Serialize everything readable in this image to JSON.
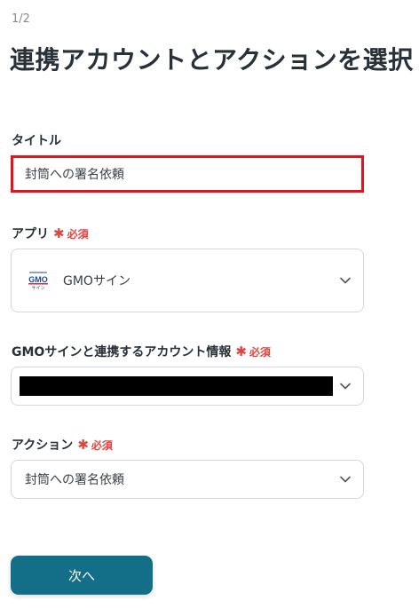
{
  "header": {
    "step": "1/2",
    "title": "連携アカウントとアクションを選択"
  },
  "required_label": "必須",
  "title_field": {
    "label": "タイトル",
    "value": "封筒への署名依頼"
  },
  "app_field": {
    "label": "アプリ",
    "value": "GMOサイン",
    "logo_icon": "gmo-sign-logo"
  },
  "account_field": {
    "label": "GMOサインと連携するアカウント情報",
    "value_redacted": true
  },
  "action_field": {
    "label": "アクション",
    "value": "封筒への署名依頼"
  },
  "next_button": {
    "label": "次へ"
  },
  "colors": {
    "primary": "#136e87",
    "required": "#e2433f",
    "highlight": "#e3131d"
  }
}
